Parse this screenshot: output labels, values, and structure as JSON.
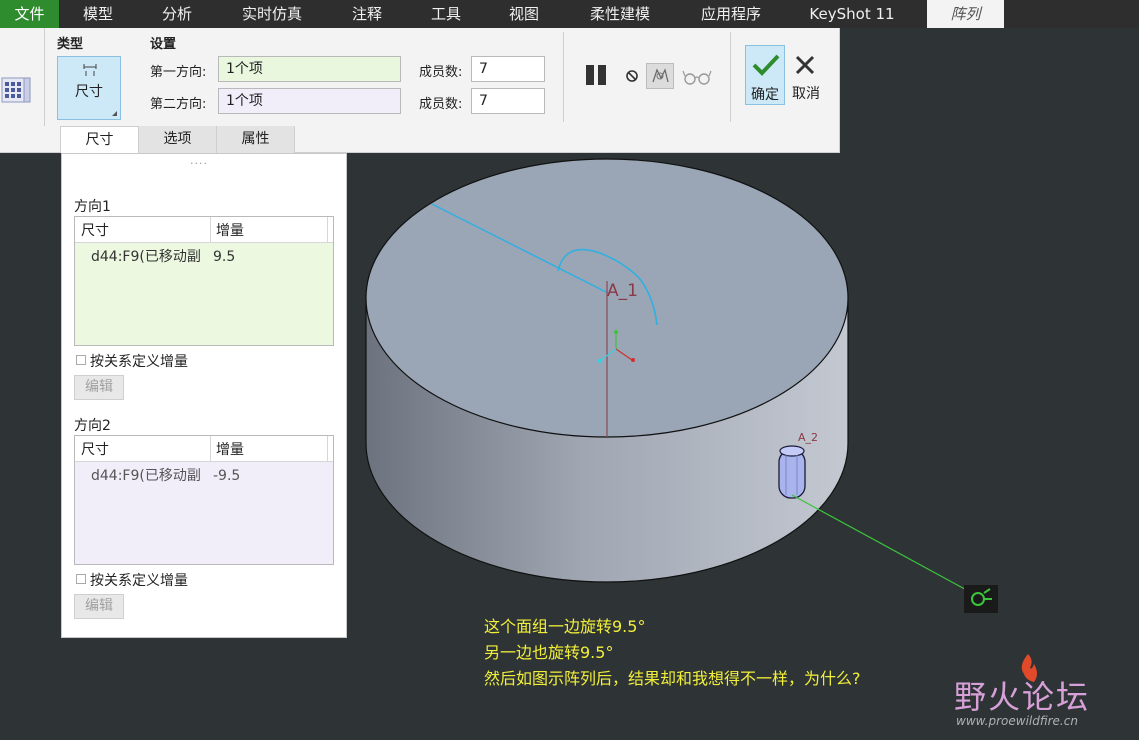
{
  "menu": {
    "file": "文件",
    "items": [
      "模型",
      "分析",
      "实时仿真",
      "注释",
      "工具",
      "视图",
      "柔性建模",
      "应用程序",
      "KeyShot 11",
      "阵列"
    ],
    "active": "阵列"
  },
  "ribbon": {
    "type_group_label": "类型",
    "type_button_label": "尺寸",
    "settings_label": "设置",
    "dir1_label": "第一方向:",
    "dir1_value": "1个项",
    "dir2_label": "第二方向:",
    "dir2_value": "1个项",
    "member_label_1": "成员数:",
    "member_value_1": "7",
    "member_label_2": "成员数:",
    "member_value_2": "7",
    "confirm_label": "确定",
    "cancel_label": "取消",
    "tabs": [
      "尺寸",
      "选项",
      "属性"
    ],
    "active_tab": "尺寸"
  },
  "panel": {
    "grip": "....",
    "direction1": {
      "title": "方向1",
      "col_dim": "尺寸",
      "col_inc": "增量",
      "row_dim": "d44:F9(已移动副",
      "row_inc": "9.5",
      "checkbox_label": "按关系定义增量",
      "edit_label": "编辑"
    },
    "direction2": {
      "title": "方向2",
      "col_dim": "尺寸",
      "col_inc": "增量",
      "row_dim": "d44:F9(已移动副",
      "row_inc": "-9.5",
      "checkbox_label": "按关系定义增量",
      "edit_label": "编辑"
    }
  },
  "viewport": {
    "axis_label": "A_1",
    "axis_label_small": "A_2",
    "annotation_lines": [
      "这个面组一边旋转9.5°",
      "另一边也旋转9.5°",
      "然后如图示阵列后，结果却和我想得不一样，为什么?"
    ]
  },
  "watermark": {
    "title": "野火论坛",
    "url": "www.proewildfire.cn"
  },
  "colors": {
    "menu_bg": "#2e2e2e",
    "file_tab": "#2e8b2e",
    "viewport_bg": "#2e3436",
    "annotation": "#f2ef3a",
    "curve": "#2fb0e0"
  }
}
